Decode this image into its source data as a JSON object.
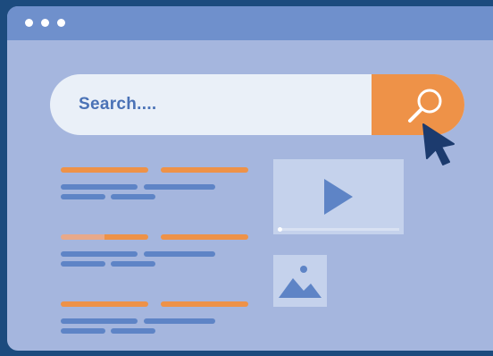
{
  "window": {
    "title_dots": [
      "dot",
      "dot",
      "dot"
    ]
  },
  "search": {
    "placeholder": "Search....",
    "button_icon": "magnifier-icon"
  },
  "cursor": {
    "icon": "mouse-pointer-icon"
  },
  "results": [
    {
      "kind": "text-result"
    },
    {
      "kind": "text-result"
    },
    {
      "kind": "text-result"
    }
  ],
  "media": {
    "video_icon": "play-icon",
    "image_icon": "image-icon"
  },
  "colors": {
    "background": "#1c4b7e",
    "window": "#a5b6de",
    "titlebar": "#6f90cc",
    "accent": "#ee9248",
    "text_lines": "#5e84c6",
    "search_field": "#eaf0f8"
  }
}
